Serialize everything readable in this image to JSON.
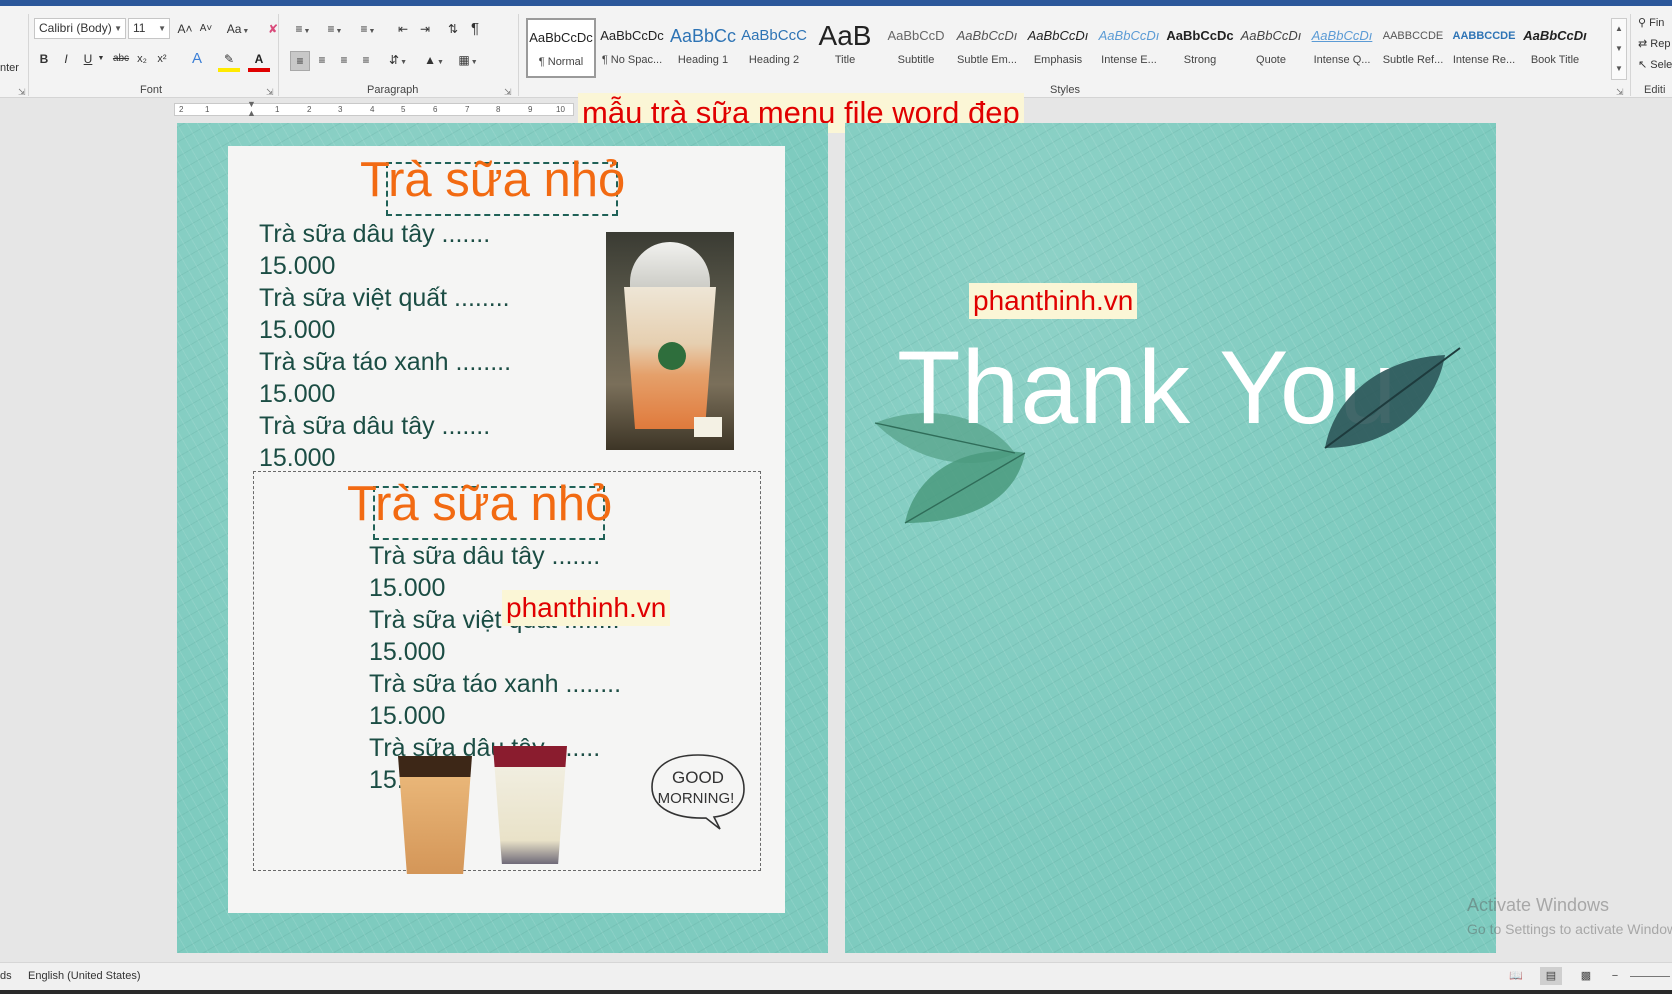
{
  "window": {
    "title": "mẫu trà sữa menu file word đẹp"
  },
  "ribbon": {
    "clipboard_cut_text": "nter",
    "font": {
      "name": "Calibri (Body)",
      "size": "11",
      "grow_label": "A˄",
      "shrink_label": "A˅",
      "case_label": "Aa",
      "bold": "B",
      "italic": "I",
      "underline": "U",
      "strike": "abc",
      "subscript": "x₂",
      "superscript": "x²",
      "group_label": "Font"
    },
    "paragraph": {
      "group_label": "Paragraph",
      "pilcrow": "¶"
    },
    "styles": {
      "group_label": "Styles",
      "items": [
        {
          "sample": "AaBbCcDc",
          "name": "¶ Normal",
          "active": true
        },
        {
          "sample": "AaBbCcDc",
          "name": "¶ No Spac...",
          "active": false
        },
        {
          "sample": "AaBbCc",
          "name": "Heading 1",
          "active": false
        },
        {
          "sample": "AaBbCcC",
          "name": "Heading 2",
          "active": false
        },
        {
          "sample": "AaB",
          "name": "Title",
          "active": false
        },
        {
          "sample": "AaBbCcD",
          "name": "Subtitle",
          "active": false
        },
        {
          "sample": "AaBbCcDı",
          "name": "Subtle Em...",
          "active": false
        },
        {
          "sample": "AaBbCcDı",
          "name": "Emphasis",
          "active": false
        },
        {
          "sample": "AaBbCcDı",
          "name": "Intense E...",
          "active": false
        },
        {
          "sample": "AaBbCcDc",
          "name": "Strong",
          "active": false
        },
        {
          "sample": "AaBbCcDı",
          "name": "Quote",
          "active": false
        },
        {
          "sample": "AaBbCcDı",
          "name": "Intense Q...",
          "active": false
        },
        {
          "sample": "AABBCCDE",
          "name": "Subtle Ref...",
          "active": false
        },
        {
          "sample": "AABBCCDE",
          "name": "Intense Re...",
          "active": false
        },
        {
          "sample": "AaBbCcDı",
          "name": "Book Title",
          "active": false
        }
      ]
    },
    "editing": {
      "find": "Fin",
      "replace": "Rep",
      "select": "Sele",
      "group_label": "Editi"
    }
  },
  "ruler": {
    "ticks": [
      "2",
      "1",
      "1",
      "2",
      "3",
      "4",
      "5",
      "6",
      "7",
      "8",
      "9",
      "10"
    ]
  },
  "page_left": {
    "menu1": {
      "title": "Trà sữa nhỏ",
      "items": [
        {
          "name": "Trà sữa dâu tây    .......",
          "price": "15.000"
        },
        {
          "name": "Trà sữa việt quất ........",
          "price": "15.000"
        },
        {
          "name": "Trà sữa táo xanh ........",
          "price": "15.000"
        },
        {
          "name": "Trà sữa dâu tây    .......",
          "price": "15.000"
        }
      ]
    },
    "menu2": {
      "title": "Trà sữa nhỏ",
      "items": [
        {
          "name": "Trà sữa dâu tây    .......",
          "price": "15.000"
        },
        {
          "name": "Trà sữa việt quất ........",
          "price": "15.000"
        },
        {
          "name": "Trà sữa táo xanh ........",
          "price": "15.000"
        },
        {
          "name": "Trà sữa dâu tây    .......",
          "price": "15.000"
        }
      ]
    },
    "watermark": "phanthinh.vn",
    "good_morning": [
      "GOOD",
      "MORNING!"
    ]
  },
  "page_right": {
    "watermark": "phanthinh.vn",
    "thank_you": "Thank You"
  },
  "activate_windows": {
    "line1": "Activate Windows",
    "line2": "Go to Settings to activate Windows."
  },
  "status": {
    "left_cut": "ds",
    "language": "English (United States)"
  },
  "colors": {
    "ribbon_blue": "#2b579a",
    "page_teal": "#7ecbbf",
    "heading_orange": "#f26a12",
    "watermark_red": "#e00000",
    "menu_text": "#1b4d44"
  }
}
